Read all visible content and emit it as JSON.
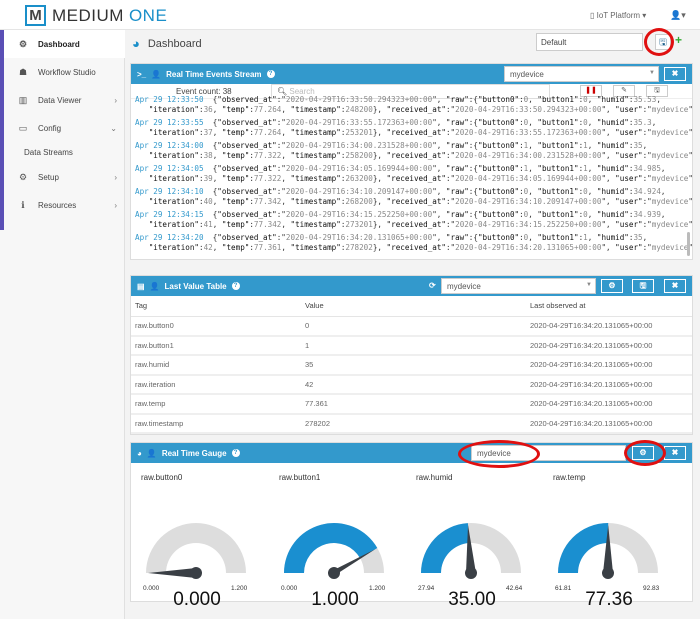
{
  "header": {
    "logo_letter": "M",
    "logo_text1": "MEDIUM",
    "logo_text2": "ONE",
    "platform": "IoT Platform ▾",
    "user_icon": "user-icon"
  },
  "sidebar": {
    "items": [
      {
        "icon": "⚙",
        "label": "Dashboard"
      },
      {
        "icon": "☗",
        "label": "Workflow Studio"
      },
      {
        "icon": "▥",
        "label": "Data Viewer",
        "chevron": "›"
      },
      {
        "icon": "▭",
        "label": "Config",
        "chevron": "⌄"
      },
      {
        "icon": "⚙",
        "label": "Setup",
        "chevron": "›"
      },
      {
        "icon": "ℹ",
        "label": "Resources",
        "chevron": "›"
      }
    ],
    "sub_item": "Data Streams"
  },
  "dashboard": {
    "title": "Dashboard",
    "select_value": "Default"
  },
  "events": {
    "title": "Real Time Events Stream",
    "device": "mydevice",
    "event_count": "Event count: 38",
    "search_placeholder": "Search",
    "keys": {
      "observed_at": "\"observed_at\"",
      "raw": "\"raw\"",
      "button0": "\"button0\"",
      "button1": "\"button1\"",
      "humid": "\"humid\"",
      "iteration": "\"iteration\"",
      "temp": "\"temp\"",
      "timestamp": "\"timestamp\"",
      "received_at": "\"received_at\"",
      "user": "\"user\""
    },
    "entries": [
      {
        "time": "Apr 29 12:33:50",
        "at": "2020-04-29T16:33:50.294323+00:00",
        "button0": "0",
        "button1": "0",
        "humid": "35.53",
        "iteration": "36",
        "temp": "77.264",
        "timestamp": "248200",
        "user": "mydevice"
      },
      {
        "time": "Apr 29 12:33:55",
        "at": "2020-04-29T16:33:55.172363+00:00",
        "button0": "0",
        "button1": "0",
        "humid": "35.3",
        "iteration": "37",
        "temp": "77.264",
        "timestamp": "253201",
        "user": "mydevice"
      },
      {
        "time": "Apr 29 12:34:00",
        "at": "2020-04-29T16:34:00.231528+00:00",
        "button0": "1",
        "button1": "1",
        "humid": "35",
        "iteration": "38",
        "temp": "77.322",
        "timestamp": "258200",
        "user": "mydevice"
      },
      {
        "time": "Apr 29 12:34:05",
        "at": "2020-04-29T16:34:05.169944+00:00",
        "button0": "1",
        "button1": "1",
        "humid": "34.985",
        "iteration": "39",
        "temp": "77.322",
        "timestamp": "263200",
        "user": "mydevice"
      },
      {
        "time": "Apr 29 12:34:10",
        "at": "2020-04-29T16:34:10.209147+00:00",
        "button0": "0",
        "button1": "0",
        "humid": "34.924",
        "iteration": "40",
        "temp": "77.342",
        "timestamp": "268200",
        "user": "mydevice"
      },
      {
        "time": "Apr 29 12:34:15",
        "at": "2020-04-29T16:34:15.252250+00:00",
        "button0": "0",
        "button1": "0",
        "humid": "34.939",
        "iteration": "41",
        "temp": "77.342",
        "timestamp": "273201",
        "user": "mydevice"
      },
      {
        "time": "Apr 29 12:34:20",
        "at": "2020-04-29T16:34:20.131065+00:00",
        "button0": "0",
        "button1": "1",
        "humid": "35",
        "iteration": "42",
        "temp": "77.361",
        "timestamp": "278202",
        "user": "mydevice"
      }
    ]
  },
  "table": {
    "title": "Last Value Table",
    "device": "mydevice",
    "columns": [
      "Tag",
      "Value",
      "Last observed at"
    ],
    "rows": [
      [
        "raw.button0",
        "0",
        "2020-04-29T16:34:20.131065+00:00"
      ],
      [
        "raw.button1",
        "1",
        "2020-04-29T16:34:20.131065+00:00"
      ],
      [
        "raw.humid",
        "35",
        "2020-04-29T16:34:20.131065+00:00"
      ],
      [
        "raw.iteration",
        "42",
        "2020-04-29T16:34:20.131065+00:00"
      ],
      [
        "raw.temp",
        "77.361",
        "2020-04-29T16:34:20.131065+00:00"
      ],
      [
        "raw.timestamp",
        "278202",
        "2020-04-29T16:34:20.131065+00:00"
      ]
    ]
  },
  "gauge": {
    "title": "Real Time Gauge",
    "device": "mydevice",
    "fill_color": "#1a8fd0",
    "track_color": "#dddddd",
    "needle_color": "#3a3f45",
    "items": [
      {
        "label": "raw.button0",
        "min": "0.000",
        "max": "1.200",
        "value": "0.000",
        "minv": 0,
        "maxv": 1.2,
        "v": 0
      },
      {
        "label": "raw.button1",
        "min": "0.000",
        "max": "1.200",
        "value": "1.000",
        "minv": 0,
        "maxv": 1.2,
        "v": 1
      },
      {
        "label": "raw.humid",
        "min": "27.94",
        "max": "42.64",
        "value": "35.00",
        "minv": 27.94,
        "maxv": 42.64,
        "v": 35
      },
      {
        "label": "raw.temp",
        "min": "61.81",
        "max": "92.83",
        "value": "77.36",
        "minv": 61.81,
        "maxv": 92.83,
        "v": 77.36
      }
    ]
  },
  "colors": {
    "accent": "#3399cc",
    "annotation": "#e01010"
  }
}
